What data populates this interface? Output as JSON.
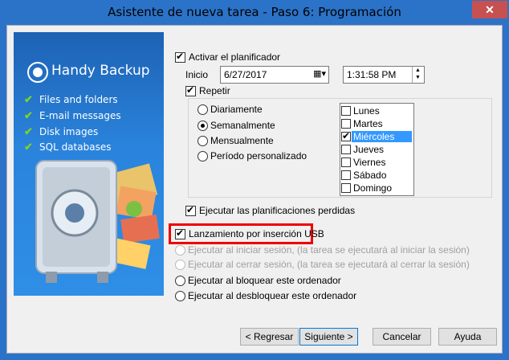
{
  "window": {
    "title": "Asistente de nueva tarea - Paso 6: Programación",
    "close": "✕"
  },
  "banner": {
    "logo": "Handy Backup",
    "features": [
      "Files and folders",
      "E-mail messages",
      "Disk images",
      "SQL databases"
    ]
  },
  "scheduler": {
    "enable_label": "Activar el planificador",
    "start_label": "Inicio",
    "date": "6/27/2017",
    "time": "1:31:58 PM",
    "repeat_label": "Repetir",
    "frequency": [
      {
        "label": "Diariamente",
        "checked": false
      },
      {
        "label": "Semanalmente",
        "checked": true
      },
      {
        "label": "Mensualmente",
        "checked": false
      },
      {
        "label": "Período personalizado",
        "checked": false
      }
    ],
    "days": [
      {
        "label": "Lunes",
        "checked": false
      },
      {
        "label": "Martes",
        "checked": false
      },
      {
        "label": "Miércoles",
        "checked": true
      },
      {
        "label": "Jueves",
        "checked": false
      },
      {
        "label": "Viernes",
        "checked": false
      },
      {
        "label": "Sábado",
        "checked": false
      },
      {
        "label": "Domingo",
        "checked": false
      }
    ],
    "run_missed_label": "Ejecutar las planificaciones perdidas"
  },
  "triggers": {
    "usb_label": "Lanzamiento por inserción USB",
    "login_label": "Ejecutar al iniciar sesión, (la tarea se ejecutará al iniciar la sesión)",
    "logoff_label": "Ejecutar al cerrar sesión, (la tarea se ejecutará al cerrar la sesión)",
    "lock_label": "Ejecutar al bloquear este ordenador",
    "unlock_label": "Ejecutar al desbloquear este ordenador"
  },
  "buttons": {
    "back": "< Regresar",
    "next": "Siguiente >",
    "cancel": "Cancelar",
    "help": "Ayuda"
  },
  "icons": {
    "calendar": "calendar-icon",
    "spinner": "spin-updown-icon",
    "check": "check-icon"
  }
}
